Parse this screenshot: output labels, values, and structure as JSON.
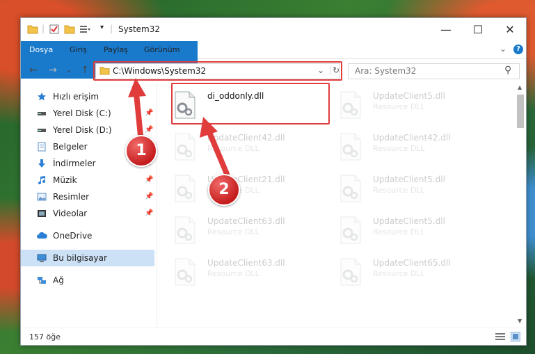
{
  "window": {
    "title": "System32",
    "controls": {
      "minimize": "—",
      "maximize": "☐",
      "close": "✕"
    }
  },
  "ribbon": {
    "tabs": [
      "Dosya",
      "Giriş",
      "Paylaş",
      "Görünüm"
    ],
    "collapse_glyph": "⌄",
    "help_glyph": "?"
  },
  "nav": {
    "back": "←",
    "forward": "→",
    "recent": "⌄",
    "up": "↑"
  },
  "address": {
    "path": "C:\\Windows\\System32",
    "dropdown": "⌄",
    "refresh": "↻"
  },
  "search": {
    "placeholder": "Ara: System32",
    "icon_glyph": "⚲"
  },
  "sidebar": {
    "items": [
      {
        "label": "Hızlı erişim",
        "icon": "star-icon"
      },
      {
        "label": "Yerel Disk (C:)",
        "icon": "drive-icon"
      },
      {
        "label": "Yerel Disk (D:)",
        "icon": "drive-icon"
      },
      {
        "label": "Belgeler",
        "icon": "documents-icon"
      },
      {
        "label": "İndirmeler",
        "icon": "download-icon"
      },
      {
        "label": "Müzik",
        "icon": "music-icon"
      },
      {
        "label": "Resimler",
        "icon": "pictures-icon"
      },
      {
        "label": "Videolar",
        "icon": "video-icon"
      },
      {
        "label": "OneDrive",
        "icon": "cloud-icon"
      },
      {
        "label": "Bu bilgisayar",
        "icon": "computer-icon"
      },
      {
        "label": "Ağ",
        "icon": "network-icon"
      }
    ],
    "pin_glyph": "📌"
  },
  "files": [
    {
      "name": "di_oddonly.dll",
      "type": ""
    },
    {
      "name": "UpdateClient5.dll",
      "type": "Resource DLL"
    },
    {
      "name": "UpdateClient42.dll",
      "type": "Resource DLL"
    },
    {
      "name": "UpdateClient42.dll",
      "type": "Resource DLL"
    },
    {
      "name": "UpdateClient21.dll",
      "type": "Resource DLL"
    },
    {
      "name": "UpdateClient5.dll",
      "type": "Resource DLL"
    },
    {
      "name": "UpdateClient63.dll",
      "type": "Resource DLL"
    },
    {
      "name": "UpdateClient5.dll",
      "type": "Resource DLL"
    },
    {
      "name": "UpdateClient63.dll",
      "type": "Resource DLL"
    },
    {
      "name": "UpdateClient65.dll",
      "type": "Resource DLL"
    }
  ],
  "status": {
    "count": "157 öğe"
  },
  "annotations": {
    "step1": "1",
    "step2": "2",
    "color": "#e03c3c"
  },
  "colors": {
    "accent": "#1979ca",
    "selection": "#cce1f5"
  }
}
